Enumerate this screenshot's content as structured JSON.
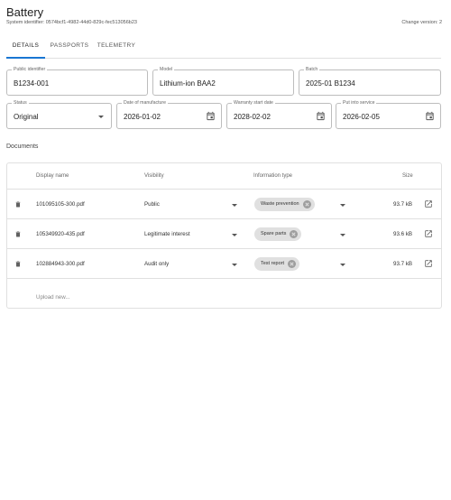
{
  "header": {
    "title": "Battery",
    "system_identifier": "System identifier: 0574bcf1-4982-44d0-829c-fec513056b23",
    "change_version": "Change version: 2"
  },
  "tabs": [
    {
      "label": "DETAILS",
      "active": true
    },
    {
      "label": "PASSPORTS",
      "active": false
    },
    {
      "label": "TELEMETRY",
      "active": false
    }
  ],
  "fields": {
    "public_identifier": {
      "label": "Public identifier",
      "value": "B1234-001"
    },
    "model": {
      "label": "Model",
      "value": "Lithium-ion BAA2"
    },
    "batch": {
      "label": "Batch",
      "value": "2025-01 B1234"
    },
    "status": {
      "label": "Status",
      "value": "Original"
    },
    "date_of_manufacture": {
      "label": "Date of manufacture",
      "value": "2026-01-02"
    },
    "warranty_start_date": {
      "label": "Warranty start date",
      "value": "2028-02-02"
    },
    "put_into_service": {
      "label": "Put into service",
      "value": "2026-02-05"
    }
  },
  "documents": {
    "heading": "Documents",
    "columns": {
      "display_name": "Display name",
      "visibility": "Visibility",
      "information_type": "Information type",
      "size": "Size"
    },
    "rows": [
      {
        "name": "101095105-300.pdf",
        "visibility": "Public",
        "info_type": "Waste prevention",
        "size": "93.7 kB"
      },
      {
        "name": "105349920-435.pdf",
        "visibility": "Legitimate interest",
        "info_type": "Spare parts",
        "size": "93.6 kB"
      },
      {
        "name": "102884943-300.pdf",
        "visibility": "Audit only",
        "info_type": "Test report",
        "size": "93.7 kB"
      }
    ],
    "upload_label": "Upload new..."
  },
  "colors": {
    "accent": "#1976d2",
    "border": "#bdbdbd",
    "chip": "#e0e0e0"
  },
  "icons": [
    "calendar-icon",
    "trash-icon",
    "open-in-new-icon",
    "chevron-down-icon",
    "chip-clear-icon"
  ]
}
